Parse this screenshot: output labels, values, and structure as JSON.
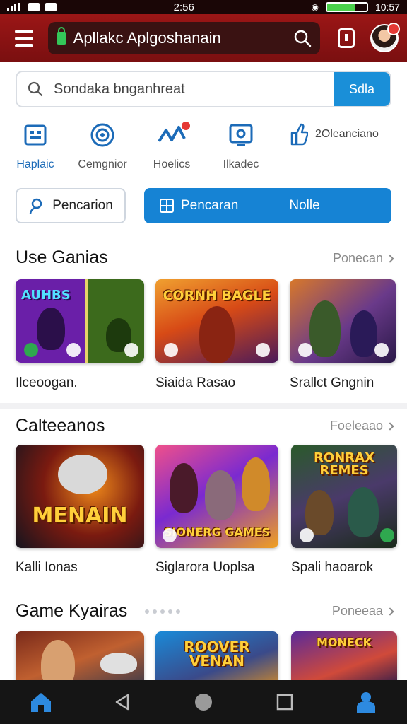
{
  "status_bar": {
    "time": "2:56",
    "battery_right_text": "10:57",
    "battery_level": 0.7
  },
  "app_bar": {
    "url_text": "Apllakc Aplgoshanain"
  },
  "search": {
    "placeholder": "Sondaka bnganhreat",
    "button_label": "Sdla"
  },
  "categories": [
    {
      "label": "Haplaic",
      "icon": "gamepad-icon",
      "active": true
    },
    {
      "label": "Cemgnior",
      "icon": "target-icon",
      "active": false
    },
    {
      "label": "Hoelics",
      "icon": "trending-icon",
      "active": false
    },
    {
      "label": "Ilkadec",
      "icon": "screen-icon",
      "active": false
    },
    {
      "label": "2Oleanciano",
      "icon": "thumbs-up-icon",
      "active": false
    }
  ],
  "filters": {
    "outline_label": "Pencarion",
    "filled_left": "Pencaran",
    "filled_right": "Nolle"
  },
  "sections": [
    {
      "title": "Use Ganias",
      "link": "Ponecan",
      "games": [
        {
          "title": "Ilceoogan.",
          "art_text": "AUHBS"
        },
        {
          "title": "Siaida Rasao",
          "art_text": "CORNH BAGLE"
        },
        {
          "title": "Srallct Gngnin",
          "art_text": ""
        }
      ]
    },
    {
      "title": "Calteeanos",
      "link": "Foeleaao",
      "games": [
        {
          "title": "Kalli Ionas",
          "art_text": "MENAIN"
        },
        {
          "title": "Siglarora Uoplsa",
          "art_text": "SIONERG GAMES"
        },
        {
          "title": "Spali haoarok",
          "art_text": "RONRAX REMES"
        }
      ]
    },
    {
      "title": "Game Kyairas",
      "link": "Poneeaa",
      "games": [
        {
          "title": "",
          "art_text": ""
        },
        {
          "title": "",
          "art_text": "ROOVER VENAN"
        },
        {
          "title": "",
          "art_text": "MONECK"
        }
      ]
    }
  ],
  "colors": {
    "app_bar": "#8f1414",
    "accent": "#1683d4",
    "active_label": "#1c6bb8"
  }
}
